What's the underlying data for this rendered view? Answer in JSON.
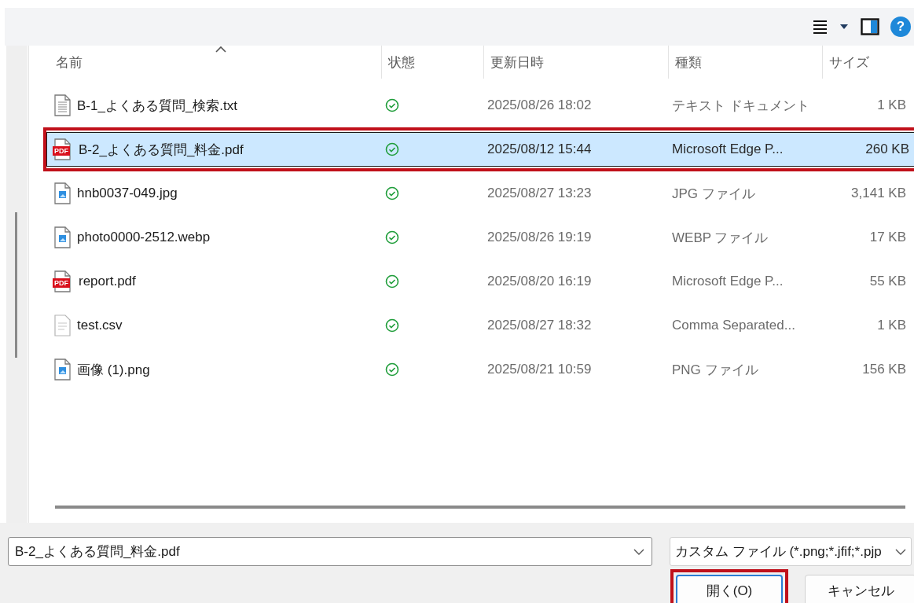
{
  "toolbar": {
    "help_label": "?"
  },
  "columns": [
    {
      "label": "名前",
      "sorted": true
    },
    {
      "label": "状態",
      "sorted": false
    },
    {
      "label": "更新日時",
      "sorted": false
    },
    {
      "label": "種類",
      "sorted": false
    },
    {
      "label": "サイズ",
      "sorted": false
    }
  ],
  "rows": [
    {
      "kind": "text",
      "name": "B-1_よくある質問_検索.txt",
      "synced": true,
      "modified": "2025/08/26 18:02",
      "type": "テキスト ドキュメント",
      "size": "1 KB",
      "selected": false,
      "highlighted": false
    },
    {
      "kind": "pdf",
      "icon_label": "PDF",
      "name": "B-2_よくある質問_料金.pdf",
      "synced": true,
      "modified": "2025/08/12 15:44",
      "type": "Microsoft Edge P...",
      "size": "260 KB",
      "selected": true,
      "highlighted": true
    },
    {
      "kind": "image",
      "name": "hnb0037-049.jpg",
      "synced": true,
      "modified": "2025/08/27 13:23",
      "type": "JPG ファイル",
      "size": "3,141 KB",
      "selected": false,
      "highlighted": false
    },
    {
      "kind": "image",
      "name": "photo0000-2512.webp",
      "synced": true,
      "modified": "2025/08/26 19:19",
      "type": "WEBP ファイル",
      "size": "17 KB",
      "selected": false,
      "highlighted": false
    },
    {
      "kind": "pdf",
      "icon_label": "PDF",
      "name": "report.pdf",
      "synced": true,
      "modified": "2025/08/20 16:19",
      "type": "Microsoft Edge P...",
      "size": "55 KB",
      "selected": false,
      "highlighted": false
    },
    {
      "kind": "csv",
      "name": "test.csv",
      "synced": true,
      "modified": "2025/08/27 18:32",
      "type": "Comma Separated...",
      "size": "1 KB",
      "selected": false,
      "highlighted": false
    },
    {
      "kind": "image",
      "name": "画像 (1).png",
      "synced": true,
      "modified": "2025/08/21 10:59",
      "type": "PNG ファイル",
      "size": "156 KB",
      "selected": false,
      "highlighted": false
    }
  ],
  "filename_field": {
    "value": "B-2_よくある質問_料金.pdf"
  },
  "filter_dropdown": {
    "value": "カスタム ファイル (*.png;*.jfif;*.pjp"
  },
  "buttons": [
    {
      "label": "開く(O)",
      "kind": "primary",
      "highlighted": true
    },
    {
      "label": "キャンセル",
      "kind": "secondary",
      "highlighted": false
    }
  ]
}
